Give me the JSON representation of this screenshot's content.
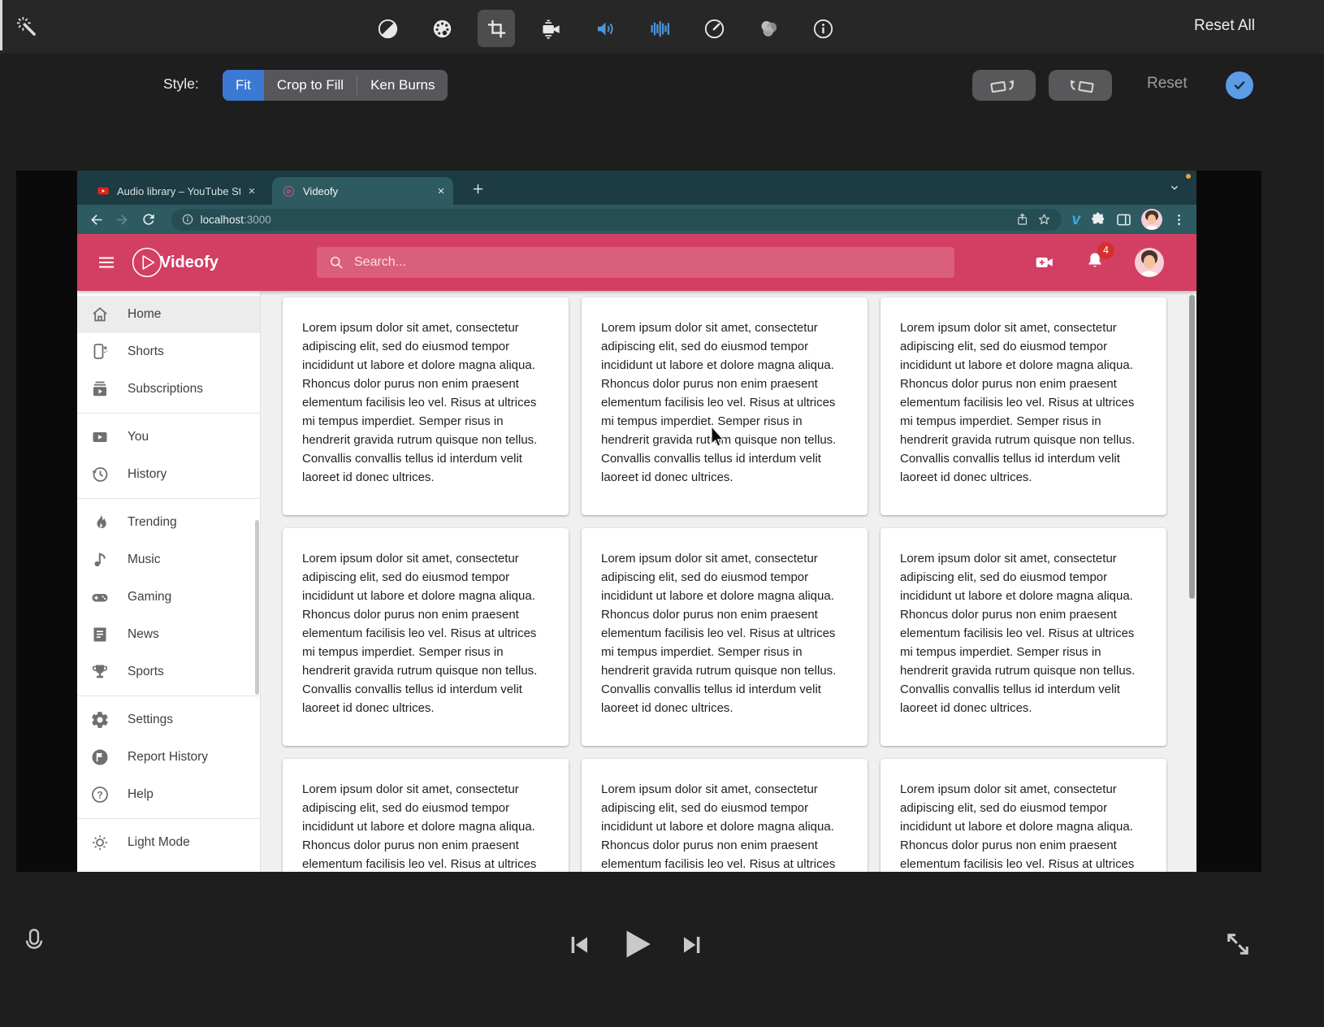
{
  "editor": {
    "toolbar": {
      "reset_all": "Reset All",
      "icons": [
        "magic-wand",
        "contrast",
        "color-palette",
        "crop",
        "camera-stabilization",
        "volume",
        "audio-levels",
        "speed-gauge",
        "color-balance-circles",
        "info"
      ],
      "selected_tool": "crop"
    },
    "style": {
      "label": "Style:",
      "options": [
        "Fit",
        "Crop to Fill",
        "Ken Burns"
      ],
      "selected": "Fit",
      "reset": "Reset"
    }
  },
  "browser": {
    "tabs": [
      {
        "title": "Audio library – YouTube Studio",
        "favicon": "youtube"
      },
      {
        "title": "Videofy",
        "favicon": "videofy-play-circle",
        "active": true
      }
    ],
    "address": {
      "host": "localhost",
      "port": ":3000"
    },
    "vimeo_glyph": "v"
  },
  "videofy": {
    "brand": "Videofy",
    "search_placeholder": "Search...",
    "notification_count": "4",
    "theme_pink": "#d33f63",
    "sidebar": [
      {
        "label": "Home",
        "icon": "home",
        "active": true
      },
      {
        "label": "Shorts",
        "icon": "shorts-phone"
      },
      {
        "label": "Subscriptions",
        "icon": "subscriptions-stack"
      },
      {
        "label": "You",
        "icon": "play-box"
      },
      {
        "label": "History",
        "icon": "history-clock"
      },
      {
        "label": "Trending",
        "icon": "flame"
      },
      {
        "label": "Music",
        "icon": "music-note"
      },
      {
        "label": "Gaming",
        "icon": "gamepad"
      },
      {
        "label": "News",
        "icon": "news-document"
      },
      {
        "label": "Sports",
        "icon": "trophy"
      },
      {
        "label": "Settings",
        "icon": "gear"
      },
      {
        "label": "Report History",
        "icon": "flag-circle"
      },
      {
        "label": "Help",
        "icon": "question-circle"
      },
      {
        "label": "Light Mode",
        "icon": "sun"
      }
    ],
    "card_text": "Lorem ipsum dolor sit amet, consectetur adipiscing elit, sed do eiusmod tempor incididunt ut labore et dolore magna aliqua. Rhoncus dolor purus non enim praesent elementum facilisis leo vel. Risus at ultrices mi tempus imperdiet. Semper risus in hendrerit gravida rutrum quisque non tellus. Convallis convallis tellus id interdum velit laoreet id donec ultrices.",
    "card_count": 9
  }
}
